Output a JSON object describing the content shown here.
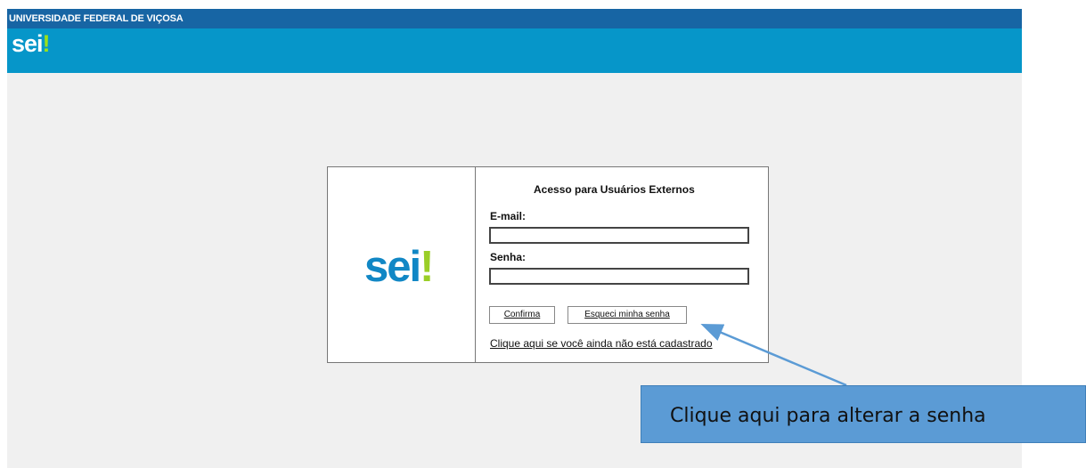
{
  "header": {
    "organization": "UNIVERSIDADE FEDERAL DE VIÇOSA",
    "logo_text": "sei",
    "logo_mark": "!"
  },
  "login": {
    "logo_text": "sei",
    "logo_mark": "!",
    "title": "Acesso para Usuários Externos",
    "email_label": "E-mail:",
    "email_value": "",
    "email_placeholder": "",
    "password_label": "Senha:",
    "password_value": "",
    "password_placeholder": "",
    "confirm_label": "Confirma",
    "forgot_label": "Esqueci minha senha",
    "signup_link": "Clique aqui se você ainda não está cadastrado"
  },
  "annotation": {
    "text": "Clique aqui para alterar a senha"
  },
  "colors": {
    "top_bar": "#1765a4",
    "brand_bar": "#0696c9",
    "page_background": "#f0f0f0",
    "logo_blue": "#1187c5",
    "logo_green": "#9ace27",
    "callout": "#5b9bd5"
  }
}
